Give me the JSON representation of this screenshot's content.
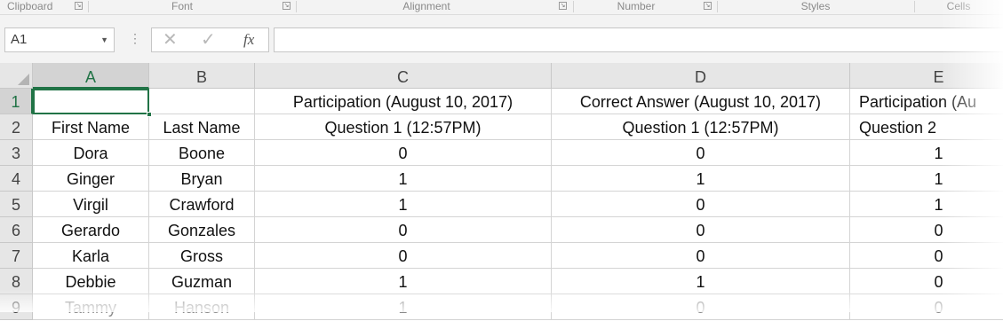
{
  "ribbon": {
    "groups": [
      "Clipboard",
      "Font",
      "Alignment",
      "Number",
      "Styles",
      "Cells"
    ]
  },
  "formula_bar": {
    "name_box": "A1",
    "cancel_icon": "close-icon",
    "enter_icon": "checkmark-icon",
    "fx_label": "fx",
    "value": ""
  },
  "columns": [
    "A",
    "B",
    "C",
    "D",
    "E"
  ],
  "rows": [
    {
      "num": "1",
      "cells": [
        "",
        "",
        "Participation (August 10, 2017)",
        "Correct Answer (August 10, 2017)",
        "Participation (Au"
      ]
    },
    {
      "num": "2",
      "cells": [
        "First Name",
        "Last Name",
        "Question 1 (12:57PM)",
        "Question 1 (12:57PM)",
        "Question 2"
      ]
    },
    {
      "num": "3",
      "cells": [
        "Dora",
        "Boone",
        "0",
        "0",
        "1"
      ]
    },
    {
      "num": "4",
      "cells": [
        "Ginger",
        "Bryan",
        "1",
        "1",
        "1"
      ]
    },
    {
      "num": "5",
      "cells": [
        "Virgil",
        "Crawford",
        "1",
        "0",
        "1"
      ]
    },
    {
      "num": "6",
      "cells": [
        "Gerardo",
        "Gonzales",
        "0",
        "0",
        "0"
      ]
    },
    {
      "num": "7",
      "cells": [
        "Karla",
        "Gross",
        "0",
        "0",
        "0"
      ]
    },
    {
      "num": "8",
      "cells": [
        "Debbie",
        "Guzman",
        "1",
        "1",
        "0"
      ]
    },
    {
      "num": "9",
      "cells": [
        "Tammy",
        "Hanson",
        "1",
        "0",
        "0"
      ]
    }
  ],
  "colors": {
    "accent": "#217346",
    "header_bg": "#e6e6e6",
    "gridline": "#d4d4d4"
  }
}
